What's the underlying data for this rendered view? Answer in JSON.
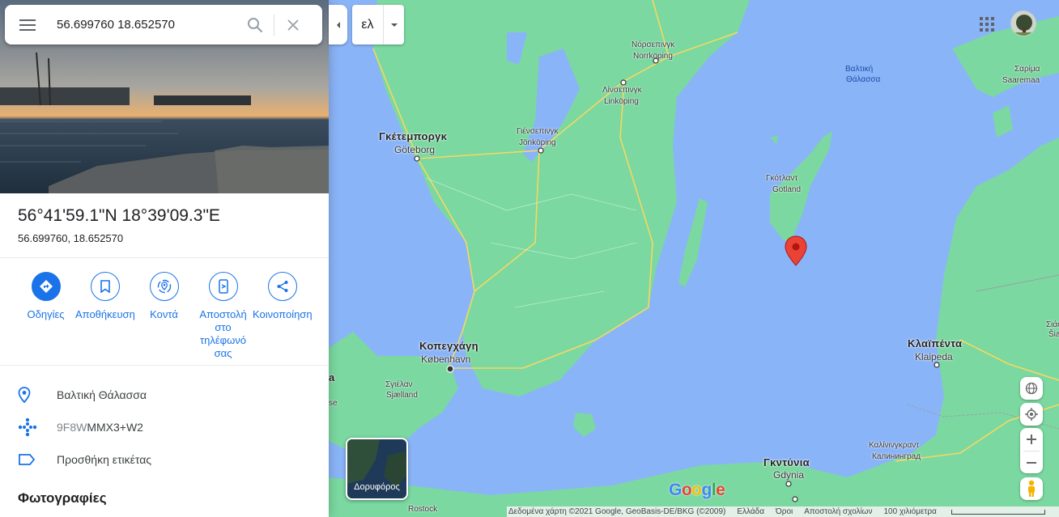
{
  "search": {
    "value": "56.699760 18.652570"
  },
  "place": {
    "title": "56°41'59.1\"N 18°39'09.3\"E",
    "decimal": "56.699760, 18.652570"
  },
  "actions": [
    {
      "label": "Οδηγίες",
      "icon": "directions-icon"
    },
    {
      "label": "Αποθήκευση",
      "icon": "bookmark-icon"
    },
    {
      "label": "Κοντά",
      "icon": "nearby-icon"
    },
    {
      "label": "Αποστολή στο τηλέφωνό σας",
      "icon": "send-to-phone-icon"
    },
    {
      "label": "Κοινοποίηση",
      "icon": "share-icon"
    }
  ],
  "info": {
    "location": "Βαλτική Θάλασσα",
    "pluscode_prefix": "9F8W",
    "pluscode_suffix": "MMX3+W2",
    "add_label": "Προσθήκη ετικέτας"
  },
  "photos_heading": "Φωτογραφίες",
  "map": {
    "lang_button": "ελ",
    "satellite_label": "Δορυφόρος",
    "labels": {
      "goteborg_gr": "Γκέτεμποργκ",
      "goteborg": "Göteborg",
      "norrkoping_gr": "Νόρσεπινγκ",
      "norrkoping": "Norrköping",
      "linkoping_gr": "Λίνσεπινγκ",
      "linkoping": "Linköping",
      "jonkoping_gr": "Γιένσεπινγκ",
      "jonkoping": "Jönköping",
      "baltic_1": "Βαλτική",
      "baltic_2": "Θάλασσα",
      "saaremaa_gr": "Σαρίμα",
      "saaremaa": "Saaremaa",
      "gotland_gr": "Γκότλαντ",
      "gotland": "Gotland",
      "copenhagen_gr": "Κοπεγχάγη",
      "copenhagen": "København",
      "zealand_gr": "Σγιέλαν",
      "zealand": "Sjælland",
      "klaipeda_gr": "Κλαϊπέντα",
      "klaipeda": "Klaipeda",
      "kaliningrad_gr": "Καλίνινγκραντ",
      "kaliningrad": "Калининград",
      "gdynia_gr": "Γκντύνια",
      "gdynia": "Gdynia",
      "rostock": "Rostock",
      "siauliai_1": "Σιάο",
      "siauliai_2": "Šia",
      "edge_a": "a",
      "edge_se": "se"
    },
    "footer": {
      "attribution": "Δεδομένα χάρτη ©2021 Google, GeoBasis-DE/BKG (©2009)",
      "country": "Ελλάδα",
      "terms": "Όροι",
      "feedback": "Αποστολή σχολίων",
      "scale": "100 χιλιόμετρα"
    }
  },
  "colors": {
    "accent": "#1a73e8",
    "water": "#8ab4f8",
    "land": "#7bd8a1",
    "pin": "#ea4335"
  }
}
